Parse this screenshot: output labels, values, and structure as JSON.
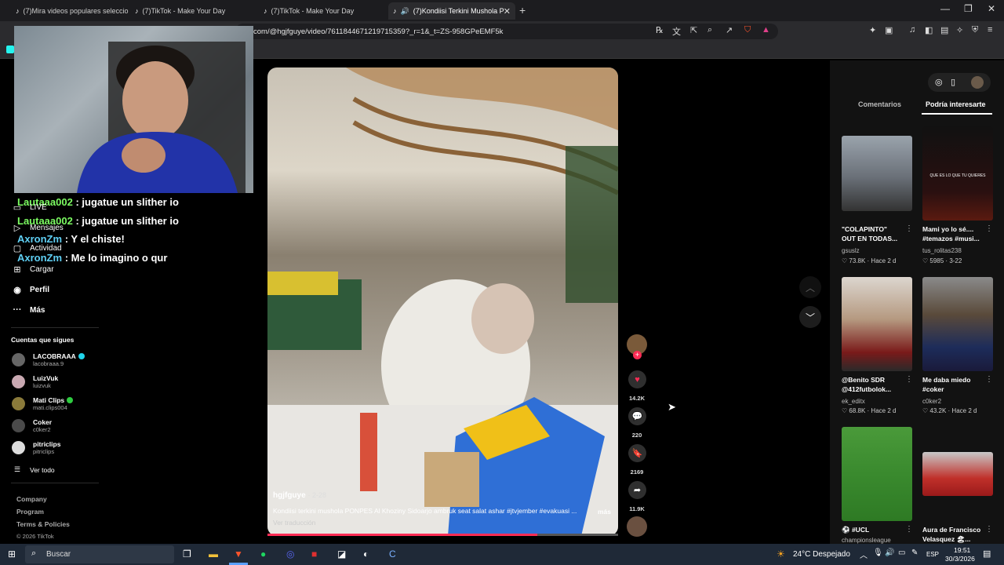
{
  "browser": {
    "tabs": [
      {
        "label": "(7)Mira videos populares seleccionad"
      },
      {
        "label": "(7)TikTok - Make Your Day"
      },
      {
        "label": "(7)TikTok - Make Your Day"
      },
      {
        "label": "(7)Kondiisi Terkini Mushola P"
      }
    ],
    "url": "com/@hgjfguye/video/7611844671219715359?_r=1&_t=ZS-958GPeEMF5k"
  },
  "chat": [
    {
      "user": "Lautaaa002",
      "message": ": jugatue un slither io"
    },
    {
      "user": "Lautaaa002",
      "message": ": jugatue un slither io"
    },
    {
      "user": "AxronZm",
      "message": ": Y el chiste!"
    },
    {
      "user": "AxronZm",
      "message": ": Me lo imagino o qur"
    }
  ],
  "sidebar": {
    "items": [
      {
        "label": "LIVE",
        "icon": "live-icon"
      },
      {
        "label": "Mensajes",
        "icon": "messages-icon"
      },
      {
        "label": "Actividad",
        "icon": "activity-icon"
      },
      {
        "label": "Cargar",
        "icon": "upload-icon"
      },
      {
        "label": "Perfil",
        "icon": "profile-icon"
      },
      {
        "label": "Más",
        "icon": "more-icon"
      }
    ],
    "following_heading": "Cuentas que sigues",
    "accounts": [
      {
        "name": "LACOBRAAA",
        "handle": "lacobraaa.9",
        "verified": "#20d5ec"
      },
      {
        "name": "LuizVuk",
        "handle": "luizvuk",
        "verified": ""
      },
      {
        "name": "Mati Clips",
        "handle": "mati.clips004",
        "verified": "#2ecc40"
      },
      {
        "name": "Coker",
        "handle": "c0ker2",
        "verified": ""
      },
      {
        "name": "pitriclips",
        "handle": "pitriclips",
        "verified": ""
      }
    ],
    "see_all": "Ver todo",
    "footer": [
      "Company",
      "Program",
      "Terms & Policies",
      "© 2026 TikTok"
    ]
  },
  "video": {
    "author": "hgjfguye",
    "date": "· 2-28",
    "caption": "Kondiisi terkini mushola PONPES Al Khoziny Sidoarjo ambruk seat salat ashar #jtvjember #evakuasi ...",
    "more": "más",
    "translate": "Ver traducción",
    "progress": 0.77
  },
  "actions": {
    "likes": "14.2K",
    "comments": "220",
    "saves": "2169",
    "shares": "11.9K"
  },
  "right_panel": {
    "tabs": [
      "Comentarios",
      "Podría interesarte"
    ],
    "cards": [
      {
        "title1": "\"COLAPINTO\"",
        "title2": "OUT EN TODAS...",
        "user": "gsuslz",
        "likes": "73.8K",
        "when": "Hace 2 d"
      },
      {
        "title1": "Mami yo lo sé....",
        "title2": "#temazos #musi...",
        "user": "tus_rolitas238",
        "likes": "5985",
        "when": "3-22",
        "overlay": "QUE ES LO QUE TU QUIERES"
      },
      {
        "title1": "@Benito SDR",
        "title2": "@412futbolok...",
        "user": "ek_editx",
        "likes": "68.8K",
        "when": "Hace 2 d"
      },
      {
        "title1": "Me daba miedo",
        "title2": "#coker",
        "user": "c0ker2",
        "likes": "43.2K",
        "when": "Hace 2 d"
      },
      {
        "title1": "#UCL",
        "title2": "",
        "user": "championsleague",
        "likes": "",
        "when": ""
      },
      {
        "title1": "Aura de Francisco",
        "title2": "Velasquez 🏖...",
        "user": "",
        "likes": "",
        "when": ""
      }
    ]
  },
  "taskbar": {
    "search": "Buscar",
    "weather": "24°C  Despejado",
    "lang": "ESP",
    "time": "19:51",
    "date": "30/3/2026"
  }
}
